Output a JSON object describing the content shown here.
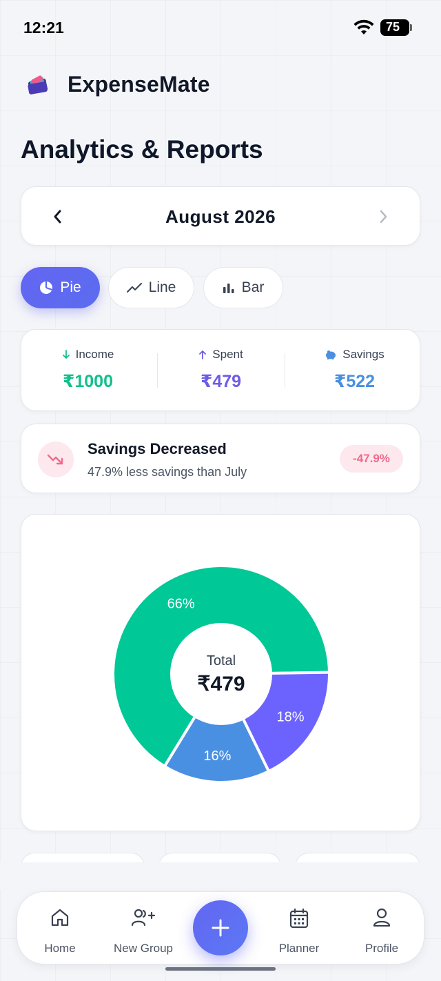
{
  "status_bar": {
    "time": "12:21",
    "battery": "75"
  },
  "app": {
    "title": "ExpenseMate"
  },
  "page": {
    "title": "Analytics & Reports"
  },
  "month_selector": {
    "label": "August 2026"
  },
  "chart_tabs": [
    {
      "label": "Pie",
      "active": true
    },
    {
      "label": "Line",
      "active": false
    },
    {
      "label": "Bar",
      "active": false
    }
  ],
  "summary": {
    "income": {
      "label": "Income",
      "value": "₹1000",
      "color": "#10c08a"
    },
    "spent": {
      "label": "Spent",
      "value": "₹479",
      "color": "#6c5ce7"
    },
    "savings": {
      "label": "Savings",
      "value": "₹522",
      "color": "#4a8fe0"
    }
  },
  "alert": {
    "title": "Savings Decreased",
    "subtitle": "47.9% less savings than July",
    "badge": "-47.9%"
  },
  "chart_center": {
    "label": "Total",
    "value": "₹479"
  },
  "chart_data": {
    "type": "pie",
    "slices": [
      {
        "label": "66%",
        "value": 66,
        "color": "#00c896"
      },
      {
        "label": "18%",
        "value": 18,
        "color": "#6c63ff"
      },
      {
        "label": "16%",
        "value": 16,
        "color": "#4a90e2"
      }
    ]
  },
  "bottom_nav": {
    "home": "Home",
    "new_group": "New Group",
    "planner": "Planner",
    "profile": "Profile"
  },
  "colors": {
    "accent": "#6366f1",
    "alert": "#ef6b8c"
  }
}
